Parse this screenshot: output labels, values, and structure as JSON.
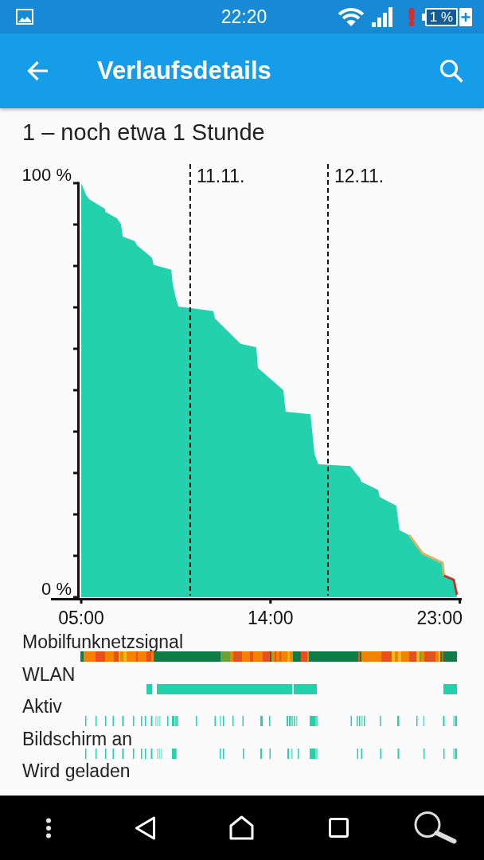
{
  "status_bar": {
    "time": "22:20",
    "battery": "1 %"
  },
  "app_bar": {
    "title": "Verlaufsdetails"
  },
  "summary": "1 – noch etwa 1 Stunde",
  "battery_chart": {
    "chart_data": {
      "type": "area",
      "x": [
        5,
        5.23,
        5.38,
        6.13,
        6.15,
        6.7,
        6.89,
        6.97,
        7.54,
        7.67,
        8.03,
        8.37,
        8.44,
        9.28,
        9.35,
        9.5,
        9.62,
        11.28,
        11.36,
        12.57,
        13.32,
        13.4,
        14.61,
        14.72,
        15.9,
        16.09,
        16.27,
        17.79,
        18.24,
        18.32,
        19.11,
        19.19,
        19.98,
        20.13,
        20.59,
        21.23,
        22.18,
        22.25,
        22.71,
        22.86
      ],
      "series": [
        {
          "color": "#23d1ad",
          "values": [
            100,
            97.1,
            96.1,
            93.8,
            93.1,
            91.5,
            90.1,
            87.1,
            86,
            84.9,
            83.4,
            81.9,
            80.3,
            79.1,
            75.6,
            72.2,
            70.2,
            69.1,
            67.3,
            61.2,
            60.4,
            55.4,
            50,
            44.8,
            44.2,
            34.6,
            32.1,
            31.7,
            28.8,
            27.9,
            25.9,
            24.2,
            22.1,
            16.2,
            15,
            10.6,
            8.3,
            5.2,
            4.2,
            0.6
          ]
        },
        {
          "type": "line",
          "color": "#d4b56a",
          "values": [
            null,
            null,
            null,
            null,
            null,
            null,
            null,
            null,
            null,
            null,
            null,
            null,
            null,
            null,
            null,
            null,
            null,
            null,
            null,
            null,
            null,
            null,
            null,
            null,
            null,
            null,
            null,
            null,
            null,
            null,
            null,
            null,
            null,
            null,
            15,
            10.6,
            8.3,
            5.2,
            null,
            null
          ]
        },
        {
          "type": "line",
          "color": "#c0392b",
          "values": [
            null,
            null,
            null,
            null,
            null,
            null,
            null,
            null,
            null,
            null,
            null,
            null,
            null,
            null,
            null,
            null,
            null,
            null,
            null,
            null,
            null,
            null,
            null,
            null,
            null,
            null,
            null,
            null,
            null,
            null,
            null,
            null,
            null,
            null,
            null,
            null,
            null,
            5.2,
            4.2,
            0.6
          ]
        }
      ],
      "xlim": [
        3.56,
        23.09
      ],
      "ylim": [
        0,
        100
      ],
      "xticks": [
        {
          "value": 5,
          "label": "05:00"
        },
        {
          "value": 14,
          "label": "14:00"
        },
        {
          "value": 23,
          "label": "23:00"
        }
      ],
      "yticks": [
        {
          "value": 0,
          "label": "0 %"
        },
        {
          "value": 100,
          "label": "100 %"
        }
      ],
      "ref_lines": [
        {
          "axis": "x",
          "value": 10.18
        },
        {
          "axis": "x",
          "value": 16.73
        }
      ],
      "annotations": [
        "11.11.",
        "12.11."
      ]
    }
  },
  "timelines": [
    {
      "kind": "signal",
      "label": "Mobilfunknetzsignal"
    },
    {
      "kind": "wifi",
      "label": "WLAN"
    },
    {
      "kind": "awake",
      "label": "Aktiv"
    },
    {
      "kind": "screen",
      "label": "Bildschirm an"
    },
    {
      "kind": "charging",
      "label": "Wird geladen"
    }
  ]
}
